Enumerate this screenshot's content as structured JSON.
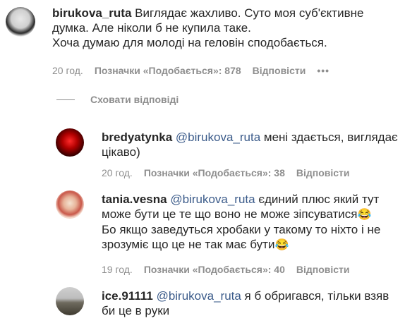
{
  "comments": [
    {
      "username": "birukova_ruta",
      "lines": [
        "Виглядає жахливо. Суто моя суб'єктивне",
        "думка. Але ніколи б не купила таке.",
        "Хоча думаю для молоді на геловін сподобається."
      ],
      "time": "20 год.",
      "likes": "Позначки «Подобається»: 878",
      "reply": "Відповісти",
      "more": "•••"
    }
  ],
  "hide_replies": "Сховати відповіді",
  "replies": [
    {
      "username": "bredyatynka",
      "mention": "@birukova_ruta",
      "line1_rest": " мені здається, виглядає",
      "line2": "цікаво)",
      "time": "20 год.",
      "likes": "Позначки «Подобається»: 38",
      "reply": "Відповісти"
    },
    {
      "username": "tania.vesna",
      "mention": "@birukova_ruta",
      "line1_rest": " єдиний плюс який тут",
      "line2": "може бути це те що воно не може зіпсуватися",
      "line3": "Бо якщо заведуться хробаки у такому то ніхто і не",
      "line4": "зрозуміє що це не так має бути",
      "emoji": "😂",
      "time": "19 год.",
      "likes": "Позначки «Подобається»: 40",
      "reply": "Відповісти"
    },
    {
      "username": "ice.91111",
      "mention": "@birukova_ruta",
      "line1_rest": " я б обригався, тільки взяв",
      "line2": "би це в руки"
    }
  ]
}
